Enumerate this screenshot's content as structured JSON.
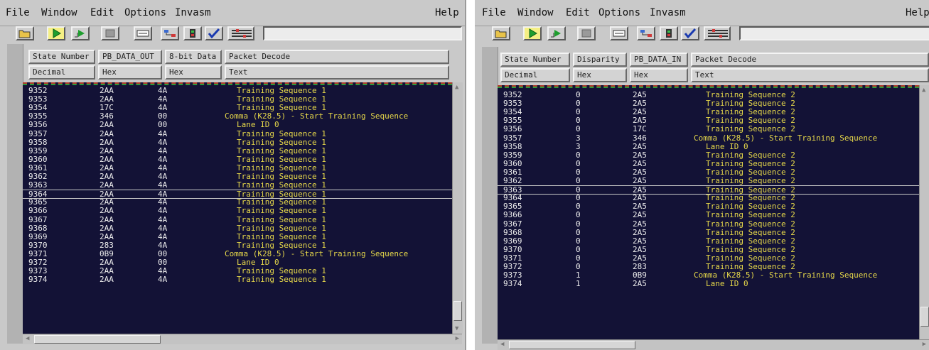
{
  "left": {
    "menu": [
      "File",
      "Window",
      "Edit",
      "Options",
      "Invasm"
    ],
    "help": "Help",
    "columns": [
      {
        "name": "State Number",
        "format": "Decimal"
      },
      {
        "name": "PB_DATA_OUT",
        "format": "Hex"
      },
      {
        "name": "8-bit Data",
        "format": "Hex"
      },
      {
        "name": "Packet Decode",
        "format": "Text"
      }
    ],
    "selected_state": "9364",
    "rows": [
      [
        "9352",
        "2AA",
        "4A",
        "Training Sequence 1"
      ],
      [
        "9353",
        "2AA",
        "4A",
        "Training Sequence 1"
      ],
      [
        "9354",
        "17C",
        "4A",
        "Training Sequence 1"
      ],
      [
        "9355",
        "346",
        "00",
        "Comma (K28.5) - Start Training Sequence"
      ],
      [
        "9356",
        "2AA",
        "00",
        "Lane ID 0"
      ],
      [
        "9357",
        "2AA",
        "4A",
        "Training Sequence 1"
      ],
      [
        "9358",
        "2AA",
        "4A",
        "Training Sequence 1"
      ],
      [
        "9359",
        "2AA",
        "4A",
        "Training Sequence 1"
      ],
      [
        "9360",
        "2AA",
        "4A",
        "Training Sequence 1"
      ],
      [
        "9361",
        "2AA",
        "4A",
        "Training Sequence 1"
      ],
      [
        "9362",
        "2AA",
        "4A",
        "Training Sequence 1"
      ],
      [
        "9363",
        "2AA",
        "4A",
        "Training Sequence 1"
      ],
      [
        "9364",
        "2AA",
        "4A",
        "Training Sequence 1"
      ],
      [
        "9365",
        "2AA",
        "4A",
        "Training Sequence 1"
      ],
      [
        "9366",
        "2AA",
        "4A",
        "Training Sequence 1"
      ],
      [
        "9367",
        "2AA",
        "4A",
        "Training Sequence 1"
      ],
      [
        "9368",
        "2AA",
        "4A",
        "Training Sequence 1"
      ],
      [
        "9369",
        "2AA",
        "4A",
        "Training Sequence 1"
      ],
      [
        "9370",
        "283",
        "4A",
        "Training Sequence 1"
      ],
      [
        "9371",
        "0B9",
        "00",
        "Comma (K28.5) - Start Training Sequence"
      ],
      [
        "9372",
        "2AA",
        "00",
        "Lane ID 0"
      ],
      [
        "9373",
        "2AA",
        "4A",
        "Training Sequence 1"
      ],
      [
        "9374",
        "2AA",
        "4A",
        "Training Sequence 1"
      ]
    ]
  },
  "right": {
    "menu": [
      "File",
      "Window",
      "Edit",
      "Options",
      "Invasm"
    ],
    "help": "Help",
    "columns": [
      {
        "name": "State Number",
        "format": "Decimal"
      },
      {
        "name": "Disparity",
        "format": "Hex"
      },
      {
        "name": "PB_DATA_IN",
        "format": "Hex"
      },
      {
        "name": "Packet Decode",
        "format": "Text"
      }
    ],
    "selected_state": "9363",
    "rows": [
      [
        "9352",
        "0",
        "2A5",
        "Training Sequence 2"
      ],
      [
        "9353",
        "0",
        "2A5",
        "Training Sequence 2"
      ],
      [
        "9354",
        "0",
        "2A5",
        "Training Sequence 2"
      ],
      [
        "9355",
        "0",
        "2A5",
        "Training Sequence 2"
      ],
      [
        "9356",
        "0",
        "17C",
        "Training Sequence 2"
      ],
      [
        "9357",
        "3",
        "346",
        "Comma (K28.5) - Start Training Sequence"
      ],
      [
        "9358",
        "3",
        "2A5",
        "Lane ID 0"
      ],
      [
        "9359",
        "0",
        "2A5",
        "Training Sequence 2"
      ],
      [
        "9360",
        "0",
        "2A5",
        "Training Sequence 2"
      ],
      [
        "9361",
        "0",
        "2A5",
        "Training Sequence 2"
      ],
      [
        "9362",
        "0",
        "2A5",
        "Training Sequence 2"
      ],
      [
        "9363",
        "0",
        "2A5",
        "Training Sequence 2"
      ],
      [
        "9364",
        "0",
        "2A5",
        "Training Sequence 2"
      ],
      [
        "9365",
        "0",
        "2A5",
        "Training Sequence 2"
      ],
      [
        "9366",
        "0",
        "2A5",
        "Training Sequence 2"
      ],
      [
        "9367",
        "0",
        "2A5",
        "Training Sequence 2"
      ],
      [
        "9368",
        "0",
        "2A5",
        "Training Sequence 2"
      ],
      [
        "9369",
        "0",
        "2A5",
        "Training Sequence 2"
      ],
      [
        "9370",
        "0",
        "2A5",
        "Training Sequence 2"
      ],
      [
        "9371",
        "0",
        "2A5",
        "Training Sequence 2"
      ],
      [
        "9372",
        "0",
        "283",
        "Training Sequence 2"
      ],
      [
        "9373",
        "1",
        "0B9",
        "Comma (K28.5) - Start Training Sequence"
      ],
      [
        "9374",
        "1",
        "2A5",
        "Lane ID 0"
      ]
    ]
  },
  "toolbar_icons": [
    "open-folder-icon",
    "run-icon",
    "run-repetitive-icon",
    "stop-icon",
    "listing-icon",
    "network-icon",
    "config-icon",
    "checkmark-icon",
    "settings-icon"
  ],
  "colors": {
    "listing_bg": "#131236",
    "packet_text": "#e6d84a",
    "value_text": "#ededed",
    "run_button": "#f5ef84"
  }
}
